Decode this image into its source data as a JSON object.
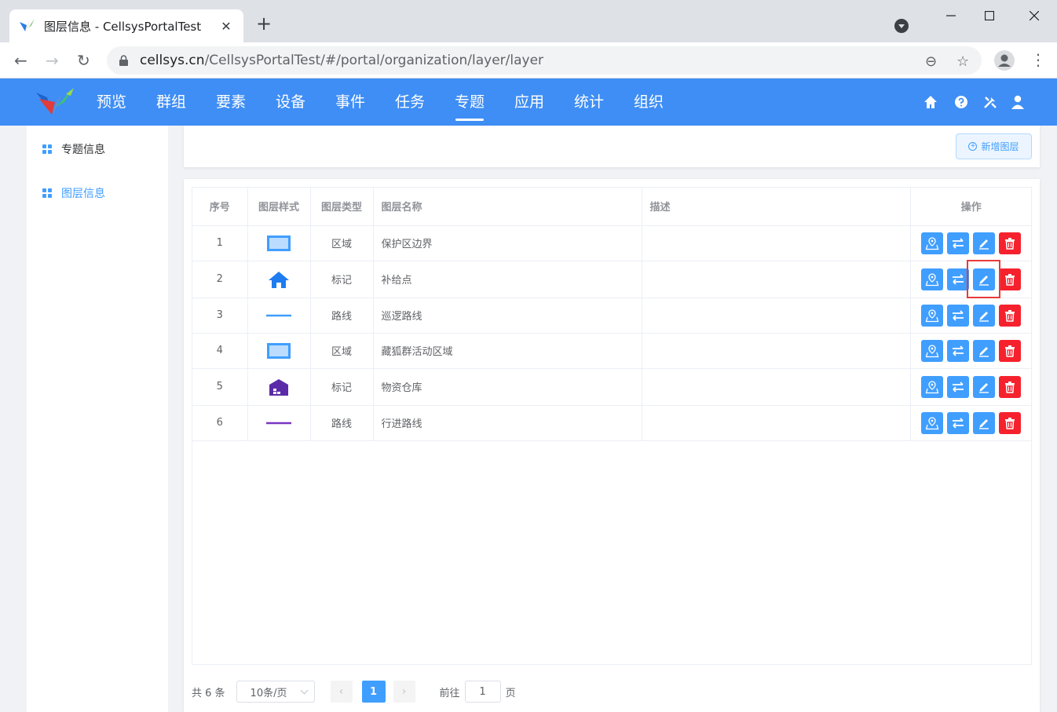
{
  "browser": {
    "tab_title": "图层信息 - CellsysPortalTest",
    "new_tab": "+",
    "tab_close": "✕",
    "url_host": "cellsys.cn",
    "url_path": "/CellsysPortalTest/#/portal/organization/layer/layer",
    "back": "←",
    "forward": "→",
    "reload": "↻",
    "zoom_icon": "⊖",
    "star_icon": "☆",
    "menu_icon": "⋮"
  },
  "app": {
    "nav": [
      "预览",
      "群组",
      "要素",
      "设备",
      "事件",
      "任务",
      "专题",
      "应用",
      "统计",
      "组织"
    ],
    "active_nav": "专题"
  },
  "sidebar": {
    "items": [
      {
        "label": "专题信息",
        "active": false
      },
      {
        "label": "图层信息",
        "active": true
      }
    ]
  },
  "toolbar": {
    "add_layer": "新增图层"
  },
  "table": {
    "headers": [
      "序号",
      "图层样式",
      "图层类型",
      "图层名称",
      "描述",
      "操作"
    ],
    "rows": [
      {
        "index": "1",
        "style": "area-blue",
        "type": "区域",
        "name": "保护区边界",
        "desc": ""
      },
      {
        "index": "2",
        "style": "marker-home-blue",
        "type": "标记",
        "name": "补给点",
        "desc": ""
      },
      {
        "index": "3",
        "style": "line-blue",
        "type": "路线",
        "name": "巡逻路线",
        "desc": ""
      },
      {
        "index": "4",
        "style": "area-blue",
        "type": "区域",
        "name": "藏狐群活动区域",
        "desc": ""
      },
      {
        "index": "5",
        "style": "marker-warehouse-purple",
        "type": "标记",
        "name": "物资仓库",
        "desc": ""
      },
      {
        "index": "6",
        "style": "line-purple",
        "type": "路线",
        "name": "行进路线",
        "desc": ""
      }
    ],
    "actions": [
      "map-pin-icon",
      "swap-icon",
      "edit-icon",
      "delete-icon"
    ]
  },
  "pagination": {
    "total": "共 6 条",
    "page_size": "10条/页",
    "prev": "‹",
    "next": "›",
    "current": "1",
    "goto_label": "前往",
    "goto_value": "1",
    "page_suffix": "页"
  },
  "colors": {
    "header": "#3f8ef5",
    "primary": "#409eff",
    "danger": "#f5222d",
    "purple": "#5b2aa8",
    "highlight": "#e83a3a"
  }
}
